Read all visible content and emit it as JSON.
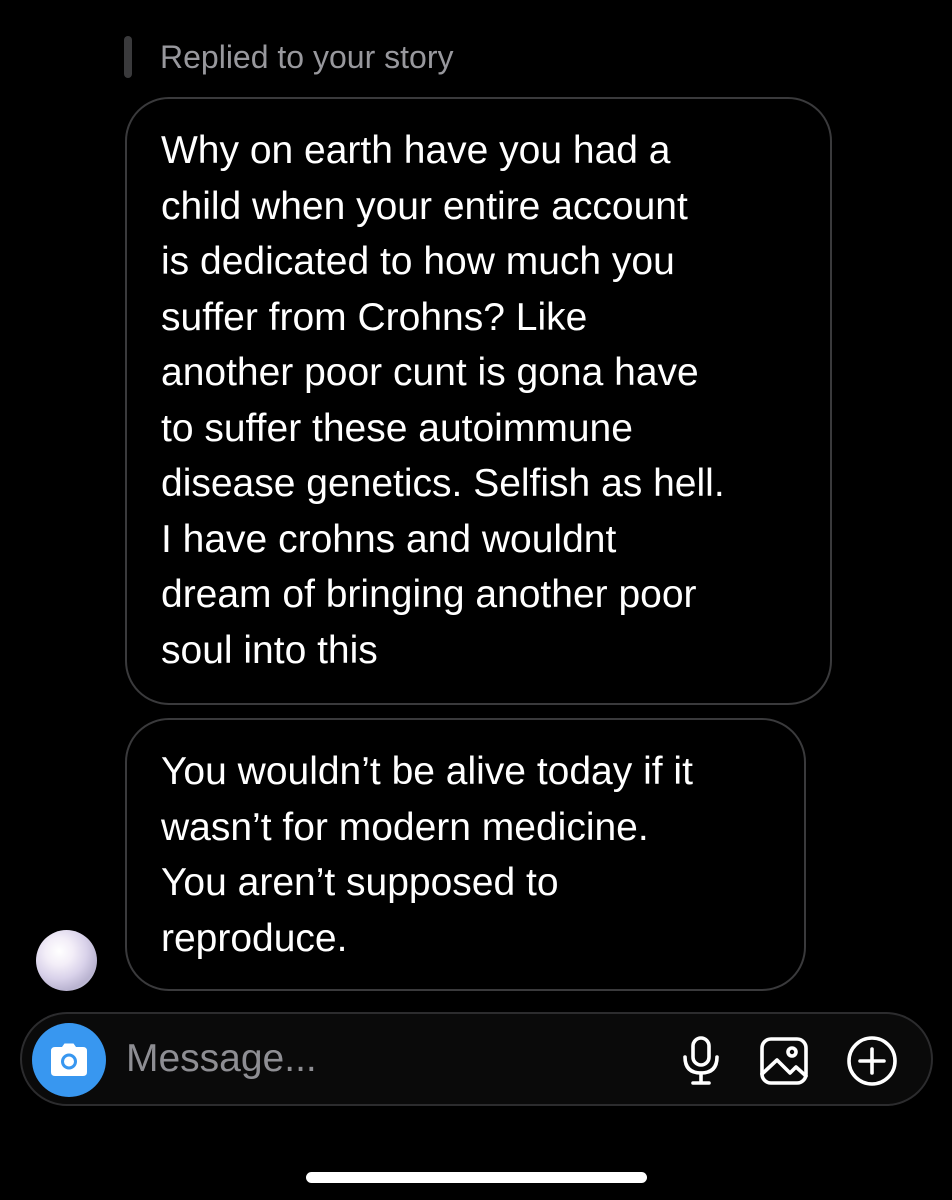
{
  "reply_context": {
    "label": "Replied to your story"
  },
  "messages": [
    {
      "lines": [
        "Why on earth have you had a",
        "child when your entire account",
        "is dedicated to how much you",
        "suffer from Crohns? Like",
        "another poor cunt is gona have",
        "to suffer these autoimmune",
        "disease genetics. Selfish as hell.",
        "I have crohns and wouldnt",
        "dream of bringing another poor",
        "soul into this"
      ]
    },
    {
      "lines": [
        "You wouldn’t be alive today if it",
        "wasn’t for modern medicine.",
        "You aren’t supposed to",
        "reproduce."
      ]
    }
  ],
  "composer": {
    "placeholder": "Message...",
    "value": "",
    "camera_icon": "camera-icon",
    "mic_icon": "microphone-icon",
    "gallery_icon": "image-gallery-icon",
    "plus_icon": "plus-circle-icon",
    "camera_color": "#3897f0"
  },
  "colors": {
    "background": "#000000",
    "bubble_border": "#3a3a3c",
    "secondary_text": "#98989d"
  }
}
